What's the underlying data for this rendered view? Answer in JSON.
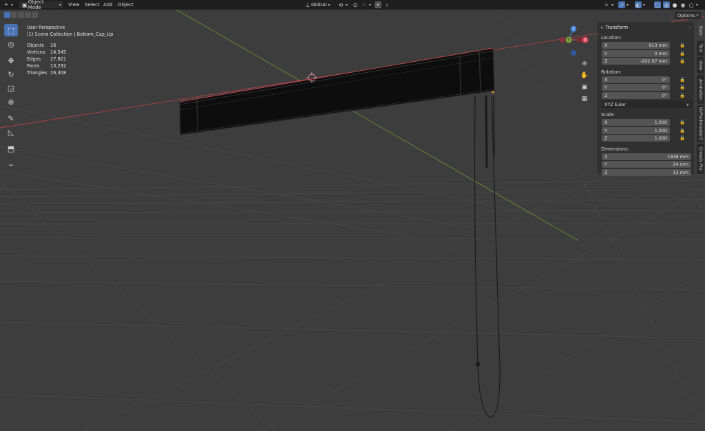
{
  "header": {
    "mode": "Object Mode",
    "menus": [
      "View",
      "Select",
      "Add",
      "Object"
    ],
    "transform_orientation": "Global"
  },
  "viewport": {
    "title": "User Perspective",
    "collection": "(1) Scene Collection | Bottom_Cap_Up",
    "stats": [
      {
        "label": "Objects",
        "value": "16"
      },
      {
        "label": "Vertices",
        "value": "14,545"
      },
      {
        "label": "Edges",
        "value": "27,821"
      },
      {
        "label": "Faces",
        "value": "13,232"
      },
      {
        "label": "Triangles",
        "value": "26,308"
      }
    ],
    "options_label": "Options",
    "gizmo": {
      "z": "Z",
      "y": "Y",
      "x": "X"
    }
  },
  "transform": {
    "title": "Transform",
    "location_label": "Location:",
    "location": [
      {
        "axis": "X",
        "value": "913 mm"
      },
      {
        "axis": "Y",
        "value": "0 mm"
      },
      {
        "axis": "Z",
        "value": "-202.97 mm"
      }
    ],
    "rotation_label": "Rotation:",
    "rotation": [
      {
        "axis": "X",
        "value": "0°"
      },
      {
        "axis": "Y",
        "value": "0°"
      },
      {
        "axis": "Z",
        "value": "0°"
      }
    ],
    "rotation_mode": "XYZ Euler",
    "scale_label": "Scale:",
    "scale": [
      {
        "axis": "X",
        "value": "1.000"
      },
      {
        "axis": "Y",
        "value": "1.000"
      },
      {
        "axis": "Z",
        "value": "1.000"
      }
    ],
    "dimensions_label": "Dimensions:",
    "dimensions": [
      {
        "axis": "X",
        "value": "1838 mm"
      },
      {
        "axis": "Y",
        "value": "24 mm"
      },
      {
        "axis": "Z",
        "value": "13 mm"
      }
    ]
  },
  "tabs": [
    "Item",
    "Tool",
    "View",
    "Animation",
    "UVPackmaster3",
    "Crowds Pro"
  ],
  "colors": {
    "accent": "#4772b3",
    "x_axis": "#c0404a",
    "y_axis": "#7fa23a",
    "z_axis": "#3f7fd8"
  }
}
